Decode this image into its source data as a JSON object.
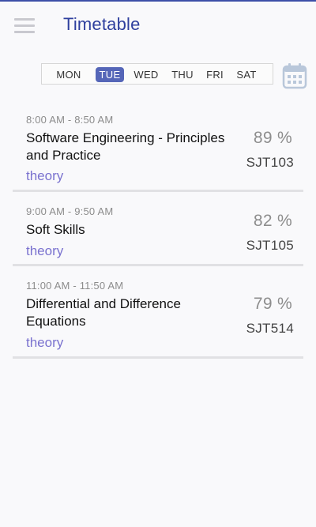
{
  "header": {
    "title": "Timetable",
    "menu_icon": "hamburger-menu-icon",
    "calendar_icon": "calendar-icon"
  },
  "days": [
    {
      "label": "MON",
      "active": false
    },
    {
      "label": "TUE",
      "active": true
    },
    {
      "label": "WED",
      "active": false
    },
    {
      "label": "THU",
      "active": false
    },
    {
      "label": "FRI",
      "active": false
    },
    {
      "label": "SAT",
      "active": false
    }
  ],
  "classes": [
    {
      "time": "8:00 AM - 8:50 AM",
      "subject": "Software Engineering - Principles and Practice",
      "type": "theory",
      "attendance": "89 %",
      "room": "SJT103"
    },
    {
      "time": "9:00 AM - 9:50 AM",
      "subject": "Soft Skills",
      "type": "theory",
      "attendance": "82 %",
      "room": "SJT105"
    },
    {
      "time": "11:00 AM - 11:50 AM",
      "subject": "Differential and Difference Equations",
      "type": "theory",
      "attendance": "79 %",
      "room": "SJT514"
    }
  ],
  "colors": {
    "accent": "#2e3f9e",
    "active_day": "#5566b8",
    "type_text": "#7a72cf"
  }
}
